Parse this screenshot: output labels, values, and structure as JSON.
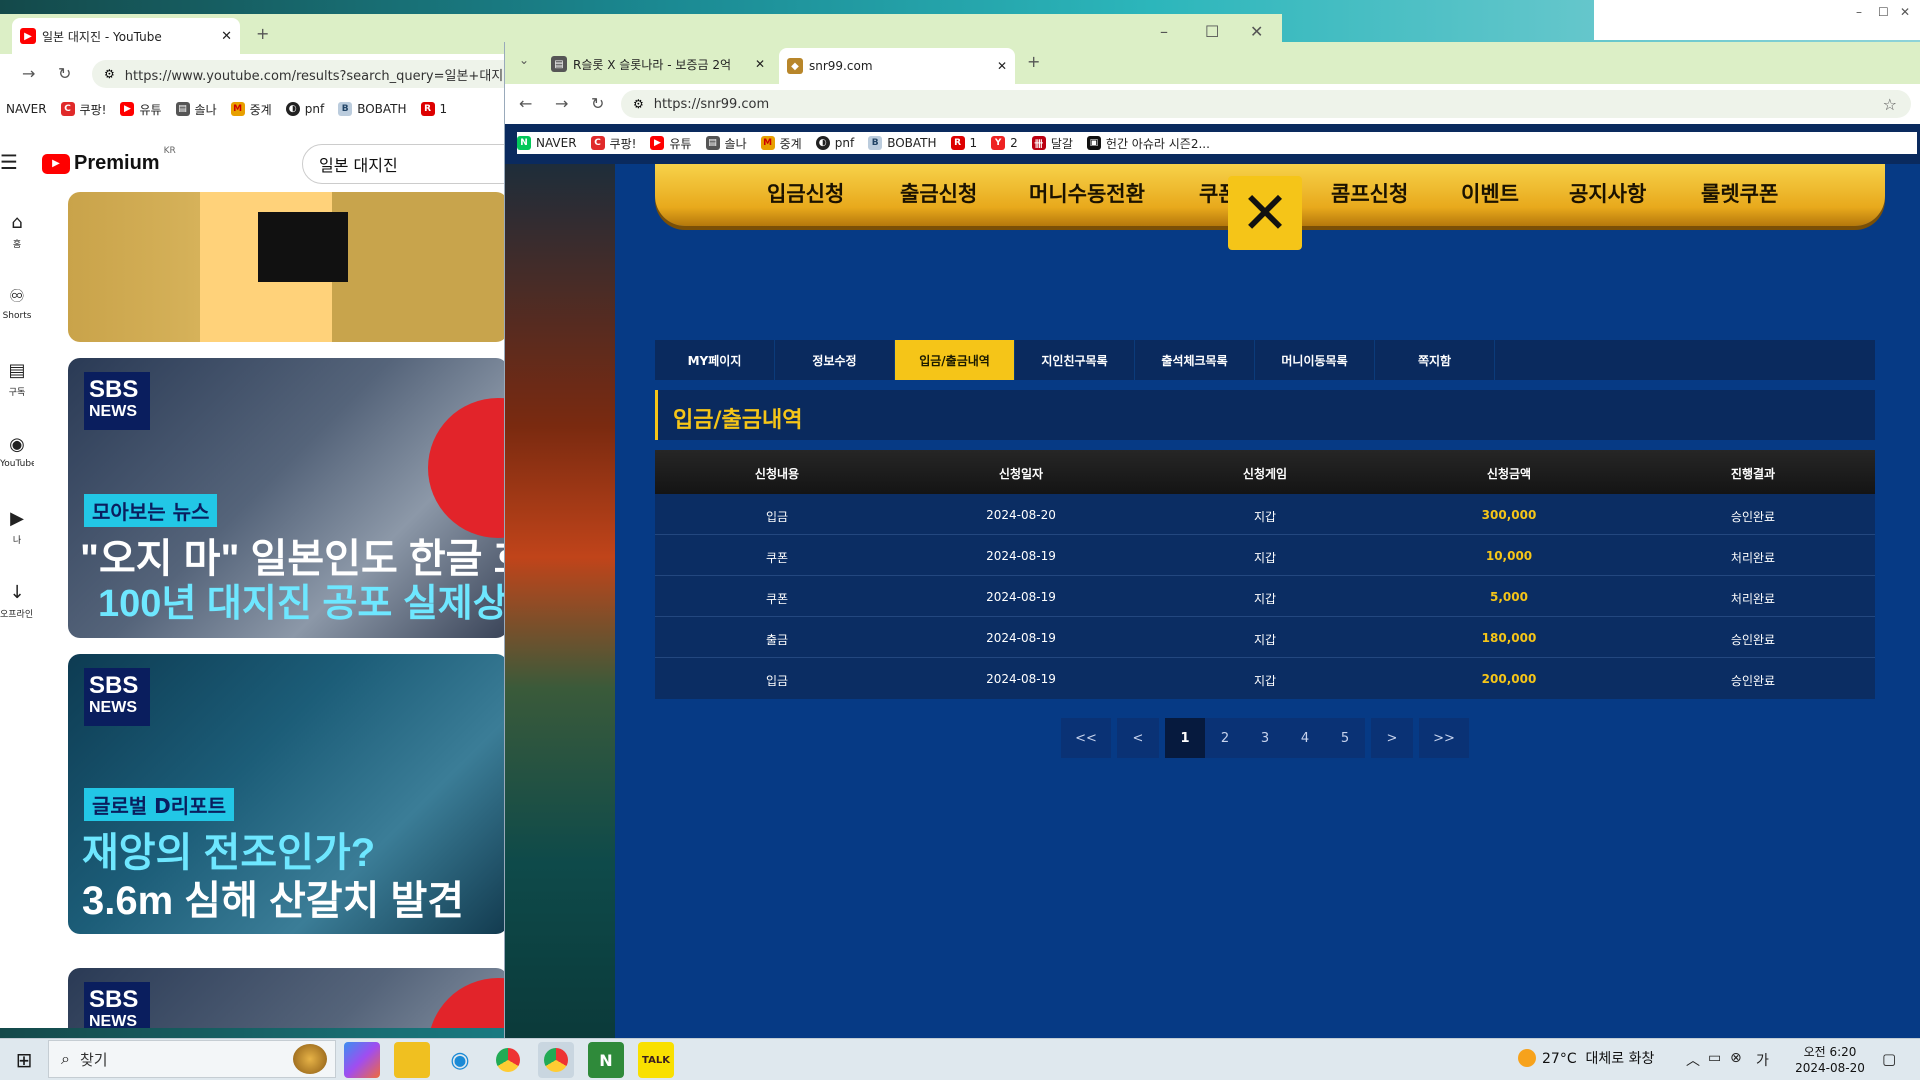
{
  "youtube_window": {
    "tab_title": "일본 대지진 - YouTube",
    "url": "https://www.youtube.com/results?search_query=일본+대지",
    "bookmarks": [
      "NAVER",
      "쿠팡!",
      "유튜",
      "솔나",
      "중계",
      "pnf",
      "BOBATH",
      "1"
    ],
    "logo_text": "Premium",
    "logo_region": "KR",
    "search_value": "일본 대지진",
    "sidebar": [
      "홈",
      "Shorts",
      "구독",
      "YouTube Mu...",
      "나",
      "오프라인 저..."
    ],
    "videos": [
      {
        "badge_a": "SBS",
        "badge_b": "NEWS",
        "tag": "모아보는 뉴스",
        "line1": "\"오지 마\" 일본인도 한글 호",
        "line2": "100년 대지진 공포 실제상"
      },
      {
        "badge_a": "SBS",
        "badge_b": "NEWS",
        "tag": "글로벌 D리포트",
        "line1": "재앙의 전조인가?",
        "line2": "3.6m 심해 산갈치 발견"
      },
      {
        "badge_a": "SBS",
        "badge_b": "NEWS"
      }
    ]
  },
  "casino_window": {
    "tabs": [
      {
        "title": "R슬롯 X 슬롯나라 - 보증금 2억"
      },
      {
        "title": "snr99.com"
      }
    ],
    "url": "https://snr99.com",
    "bookmarks": [
      "NAVER",
      "쿠팡!",
      "유튜",
      "솔나",
      "중계",
      "pnf",
      "BOBATH",
      "1",
      "2",
      "달갈",
      "헌간 아슈라 시즌2..."
    ],
    "nav": [
      "입금신청",
      "출금신청",
      "머니수동전환",
      "쿠폰",
      "콤프신청",
      "이벤트",
      "공지사항",
      "룰렛쿠폰"
    ],
    "subtabs": [
      "MY페이지",
      "정보수정",
      "입금/출금내역",
      "지인친구목록",
      "출석체크목록",
      "머니이동목록",
      "쪽지함"
    ],
    "active_subtab": "입금/출금내역",
    "section_title": "입금/출금내역",
    "table_headers": [
      "신청내용",
      "신청일자",
      "신청게임",
      "신청금액",
      "진행결과"
    ],
    "rows": [
      [
        "입금",
        "2024-08-20",
        "지갑",
        "300,000",
        "승인완료"
      ],
      [
        "쿠폰",
        "2024-08-19",
        "지갑",
        "10,000",
        "처리완료"
      ],
      [
        "쿠폰",
        "2024-08-19",
        "지갑",
        "5,000",
        "처리완료"
      ],
      [
        "출금",
        "2024-08-19",
        "지갑",
        "180,000",
        "승인완료"
      ],
      [
        "입금",
        "2024-08-19",
        "지갑",
        "200,000",
        "승인완료"
      ]
    ],
    "pagination": {
      "first": "<<",
      "prev": "<",
      "pages": [
        "1",
        "2",
        "3",
        "4",
        "5"
      ],
      "current": "1",
      "next": ">",
      "last": ">>"
    }
  },
  "taskbar": {
    "search_placeholder": "찾기",
    "weather": "27°C  대체로 화창",
    "time": "오전 6:20",
    "date": "2024-08-20"
  },
  "colors": {
    "accent_gold": "#f5c518",
    "panel_blue": "#063a85",
    "dark_blue": "#0a2a5e"
  }
}
